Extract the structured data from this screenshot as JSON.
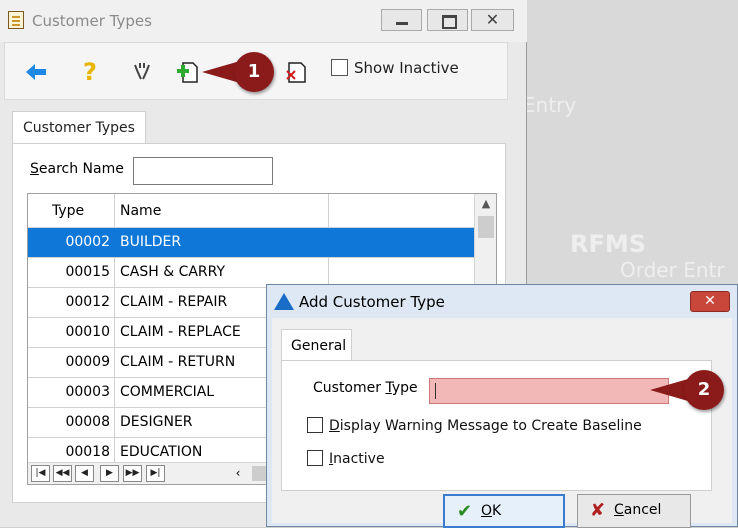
{
  "main_window": {
    "title": "Customer Types",
    "toolbar": {
      "show_inactive_label": "Show Inactive",
      "show_inactive_checked": false
    },
    "tab_label": "Customer Types",
    "search": {
      "label_prefix": "S",
      "label_rest": "earch Name",
      "value": ""
    },
    "grid": {
      "headers": {
        "type": "Type",
        "name": "Name"
      },
      "rows": [
        {
          "type": "00002",
          "name": "BUILDER",
          "selected": true
        },
        {
          "type": "00015",
          "name": "CASH & CARRY",
          "selected": false
        },
        {
          "type": "00012",
          "name": "CLAIM - REPAIR",
          "selected": false
        },
        {
          "type": "00010",
          "name": "CLAIM - REPLACE",
          "selected": false
        },
        {
          "type": "00009",
          "name": "CLAIM - RETURN",
          "selected": false
        },
        {
          "type": "00003",
          "name": "COMMERCIAL",
          "selected": false
        },
        {
          "type": "00008",
          "name": "DESIGNER",
          "selected": false
        },
        {
          "type": "00018",
          "name": "EDUCATION",
          "selected": false
        }
      ]
    }
  },
  "dialog": {
    "title": "Add Customer Type",
    "tab_label": "General",
    "customer_type_label_a": "Customer ",
    "customer_type_label_u": "T",
    "customer_type_label_b": "ype",
    "customer_type_value": "",
    "display_warning_u": "D",
    "display_warning_rest": "isplay Warning Message to Create Baseline",
    "inactive_u": "I",
    "inactive_rest": "nactive",
    "ok_u": "O",
    "ok_rest": "K",
    "cancel_u": "C",
    "cancel_rest": "ancel"
  },
  "callouts": {
    "one": "1",
    "two": "2"
  },
  "background": {
    "watermark_1": "Entry",
    "watermark_2": "RFMS",
    "watermark_3": "Order Entr"
  },
  "colors": {
    "selection": "#0f77d8",
    "required_field": "#f2b8b8",
    "callout": "#8b1a1a"
  }
}
